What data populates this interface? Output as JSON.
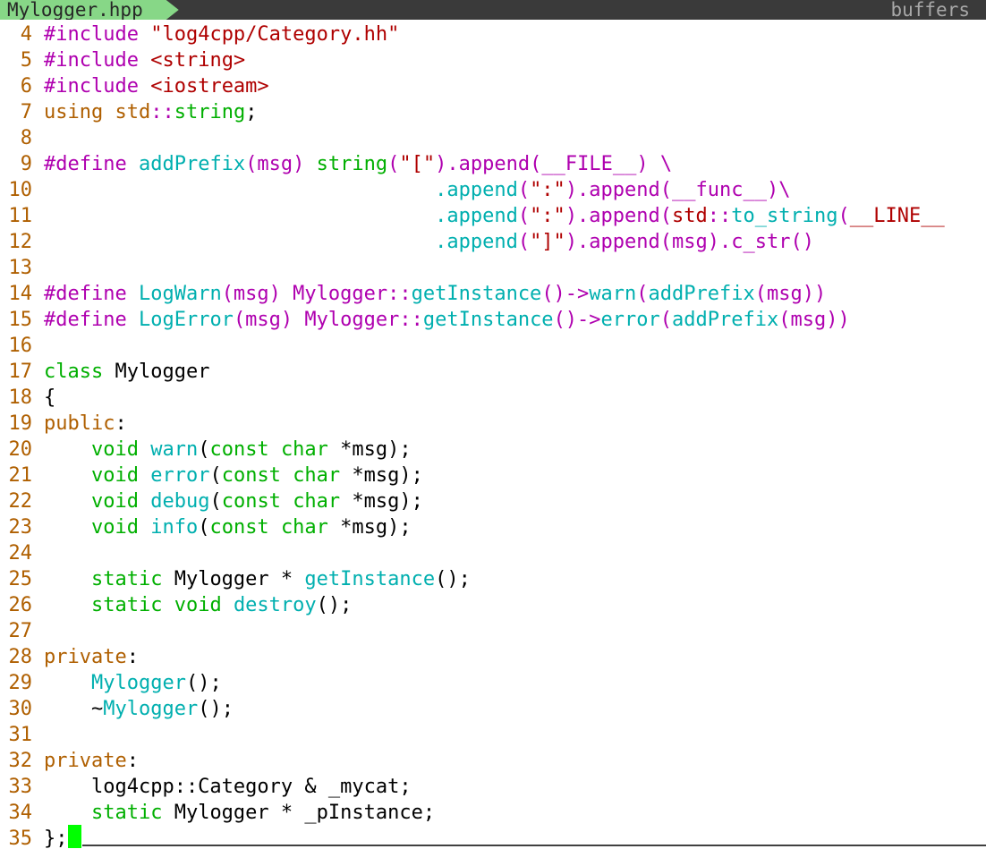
{
  "tabline": {
    "active_tab": "Mylogger.hpp",
    "right_label": "buffers"
  },
  "colors": {
    "line_number": "#af5f00",
    "preprocessor": "#af00af",
    "string": "#af0000",
    "keyword": "#af5f00",
    "type": "#00af00",
    "function": "#00afaf",
    "text": "#000000",
    "cursor": "#00ff00",
    "tab_active_bg": "#87d787",
    "tabline_bg": "#3a3a3a"
  },
  "lines": [
    {
      "num": "4",
      "tokens": [
        {
          "t": "#include ",
          "c": "pre"
        },
        {
          "t": "\"log4cpp/Category.hh\"",
          "c": "str"
        }
      ]
    },
    {
      "num": "5",
      "tokens": [
        {
          "t": "#include ",
          "c": "pre"
        },
        {
          "t": "<string>",
          "c": "str"
        }
      ]
    },
    {
      "num": "6",
      "tokens": [
        {
          "t": "#include ",
          "c": "pre"
        },
        {
          "t": "<iostream>",
          "c": "str"
        }
      ]
    },
    {
      "num": "7",
      "tokens": [
        {
          "t": "using ",
          "c": "kw"
        },
        {
          "t": "std",
          "c": "kw"
        },
        {
          "t": "::",
          "c": "pre"
        },
        {
          "t": "string",
          "c": "type"
        },
        {
          "t": ";",
          "c": "n"
        }
      ]
    },
    {
      "num": "8",
      "tokens": []
    },
    {
      "num": "9",
      "tokens": [
        {
          "t": "#define ",
          "c": "pre"
        },
        {
          "t": "addPrefix",
          "c": "fn"
        },
        {
          "t": "(msg) ",
          "c": "pre"
        },
        {
          "t": "string",
          "c": "type"
        },
        {
          "t": "(",
          "c": "pre"
        },
        {
          "t": "\"[\"",
          "c": "str"
        },
        {
          "t": ").append(__FILE__) \\",
          "c": "pre"
        }
      ]
    },
    {
      "num": "10",
      "tokens": [
        {
          "t": "                                 ",
          "c": "n"
        },
        {
          "t": ".append",
          "c": "fn"
        },
        {
          "t": "(",
          "c": "pre"
        },
        {
          "t": "\":\"",
          "c": "str"
        },
        {
          "t": ").append(__func__)\\",
          "c": "pre"
        }
      ]
    },
    {
      "num": "11",
      "tokens": [
        {
          "t": "                                 ",
          "c": "n"
        },
        {
          "t": ".append",
          "c": "fn"
        },
        {
          "t": "(",
          "c": "pre"
        },
        {
          "t": "\":\"",
          "c": "str"
        },
        {
          "t": ").append(",
          "c": "pre"
        },
        {
          "t": "std",
          "c": "str"
        },
        {
          "t": "::",
          "c": "pre"
        },
        {
          "t": "to_string",
          "c": "fn"
        },
        {
          "t": "(",
          "c": "pre"
        },
        {
          "t": "__LINE__",
          "c": "str"
        }
      ]
    },
    {
      "num": "12",
      "tokens": [
        {
          "t": "                                 ",
          "c": "n"
        },
        {
          "t": ".append",
          "c": "fn"
        },
        {
          "t": "(",
          "c": "pre"
        },
        {
          "t": "\"]\"",
          "c": "str"
        },
        {
          "t": ").append(msg).c_str()",
          "c": "pre"
        }
      ]
    },
    {
      "num": "13",
      "tokens": []
    },
    {
      "num": "14",
      "tokens": [
        {
          "t": "#define ",
          "c": "pre"
        },
        {
          "t": "LogWarn",
          "c": "fn"
        },
        {
          "t": "(msg) Mylogger::",
          "c": "pre"
        },
        {
          "t": "getInstance",
          "c": "fn"
        },
        {
          "t": "()->",
          "c": "pre"
        },
        {
          "t": "warn",
          "c": "fn"
        },
        {
          "t": "(",
          "c": "pre"
        },
        {
          "t": "addPrefix",
          "c": "fn"
        },
        {
          "t": "(msg))",
          "c": "pre"
        }
      ]
    },
    {
      "num": "15",
      "tokens": [
        {
          "t": "#define ",
          "c": "pre"
        },
        {
          "t": "LogError",
          "c": "fn"
        },
        {
          "t": "(msg) Mylogger::",
          "c": "pre"
        },
        {
          "t": "getInstance",
          "c": "fn"
        },
        {
          "t": "()->",
          "c": "pre"
        },
        {
          "t": "error",
          "c": "fn"
        },
        {
          "t": "(",
          "c": "pre"
        },
        {
          "t": "addPrefix",
          "c": "fn"
        },
        {
          "t": "(msg))",
          "c": "pre"
        }
      ]
    },
    {
      "num": "16",
      "tokens": []
    },
    {
      "num": "17",
      "tokens": [
        {
          "t": "class ",
          "c": "type"
        },
        {
          "t": "Mylogger",
          "c": "n"
        }
      ]
    },
    {
      "num": "18",
      "tokens": [
        {
          "t": "{",
          "c": "n"
        }
      ]
    },
    {
      "num": "19",
      "tokens": [
        {
          "t": "public",
          "c": "kw"
        },
        {
          "t": ":",
          "c": "n"
        }
      ]
    },
    {
      "num": "20",
      "tokens": [
        {
          "t": "    ",
          "c": "n"
        },
        {
          "t": "void ",
          "c": "type"
        },
        {
          "t": "warn",
          "c": "fn"
        },
        {
          "t": "(",
          "c": "n"
        },
        {
          "t": "const ",
          "c": "type"
        },
        {
          "t": "char ",
          "c": "type"
        },
        {
          "t": "*msg);",
          "c": "n"
        }
      ]
    },
    {
      "num": "21",
      "tokens": [
        {
          "t": "    ",
          "c": "n"
        },
        {
          "t": "void ",
          "c": "type"
        },
        {
          "t": "error",
          "c": "fn"
        },
        {
          "t": "(",
          "c": "n"
        },
        {
          "t": "const ",
          "c": "type"
        },
        {
          "t": "char ",
          "c": "type"
        },
        {
          "t": "*msg);",
          "c": "n"
        }
      ]
    },
    {
      "num": "22",
      "tokens": [
        {
          "t": "    ",
          "c": "n"
        },
        {
          "t": "void ",
          "c": "type"
        },
        {
          "t": "debug",
          "c": "fn"
        },
        {
          "t": "(",
          "c": "n"
        },
        {
          "t": "const ",
          "c": "type"
        },
        {
          "t": "char ",
          "c": "type"
        },
        {
          "t": "*msg);",
          "c": "n"
        }
      ]
    },
    {
      "num": "23",
      "tokens": [
        {
          "t": "    ",
          "c": "n"
        },
        {
          "t": "void ",
          "c": "type"
        },
        {
          "t": "info",
          "c": "fn"
        },
        {
          "t": "(",
          "c": "n"
        },
        {
          "t": "const ",
          "c": "type"
        },
        {
          "t": "char ",
          "c": "type"
        },
        {
          "t": "*msg);",
          "c": "n"
        }
      ]
    },
    {
      "num": "24",
      "tokens": []
    },
    {
      "num": "25",
      "tokens": [
        {
          "t": "    ",
          "c": "n"
        },
        {
          "t": "static ",
          "c": "type"
        },
        {
          "t": "Mylogger * ",
          "c": "n"
        },
        {
          "t": "getInstance",
          "c": "fn"
        },
        {
          "t": "();",
          "c": "n"
        }
      ]
    },
    {
      "num": "26",
      "tokens": [
        {
          "t": "    ",
          "c": "n"
        },
        {
          "t": "static ",
          "c": "type"
        },
        {
          "t": "void ",
          "c": "type"
        },
        {
          "t": "destroy",
          "c": "fn"
        },
        {
          "t": "();",
          "c": "n"
        }
      ]
    },
    {
      "num": "27",
      "tokens": []
    },
    {
      "num": "28",
      "tokens": [
        {
          "t": "private",
          "c": "kw"
        },
        {
          "t": ":",
          "c": "n"
        }
      ]
    },
    {
      "num": "29",
      "tokens": [
        {
          "t": "    ",
          "c": "n"
        },
        {
          "t": "Mylogger",
          "c": "fn"
        },
        {
          "t": "();",
          "c": "n"
        }
      ]
    },
    {
      "num": "30",
      "tokens": [
        {
          "t": "    ~",
          "c": "n"
        },
        {
          "t": "Mylogger",
          "c": "fn"
        },
        {
          "t": "();",
          "c": "n"
        }
      ]
    },
    {
      "num": "31",
      "tokens": []
    },
    {
      "num": "32",
      "tokens": [
        {
          "t": "private",
          "c": "kw"
        },
        {
          "t": ":",
          "c": "n"
        }
      ]
    },
    {
      "num": "33",
      "tokens": [
        {
          "t": "    log4cpp::Category & _mycat;",
          "c": "n"
        }
      ]
    },
    {
      "num": "34",
      "tokens": [
        {
          "t": "    ",
          "c": "n"
        },
        {
          "t": "static ",
          "c": "type"
        },
        {
          "t": "Mylogger * _pInstance;",
          "c": "n"
        }
      ]
    },
    {
      "num": "35",
      "tokens": [
        {
          "t": "};",
          "c": "n"
        }
      ]
    }
  ]
}
